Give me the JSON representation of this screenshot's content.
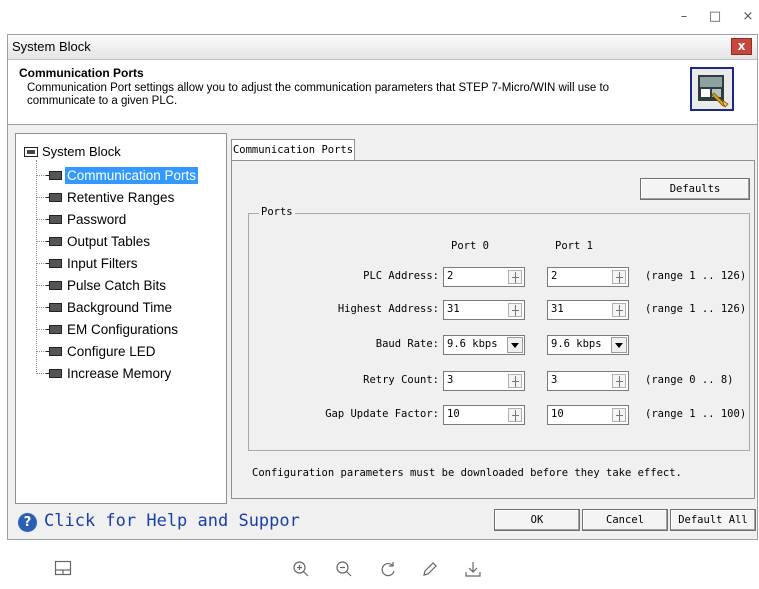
{
  "window": {
    "minimize": "–",
    "maximize": "□",
    "close": "×"
  },
  "dialog": {
    "title": "System Block",
    "close": "x",
    "header": {
      "title": "Communication Ports",
      "description": "Communication Port settings allow you to adjust the communication parameters that STEP 7-Micro/WIN will use to communicate to a given PLC."
    }
  },
  "tree": {
    "root": "System Block",
    "items": [
      "Communication Ports",
      "Retentive Ranges",
      "Password",
      "Output Tables",
      "Input Filters",
      "Pulse Catch Bits",
      "Background Time",
      "EM Configurations",
      "Configure LED",
      "Increase Memory"
    ],
    "selected_index": 0
  },
  "tab": {
    "label": "Communication Ports"
  },
  "panel": {
    "defaults_button": "Defaults",
    "group_label": "Ports",
    "port0_header": "Port 0",
    "port1_header": "Port 1",
    "rows": {
      "plc_address": {
        "label": "PLC Address:",
        "port0": "2",
        "port1": "2",
        "range": "(range 1 .. 126)"
      },
      "highest_address": {
        "label": "Highest Address:",
        "port0": "31",
        "port1": "31",
        "range": "(range 1 .. 126)"
      },
      "baud_rate": {
        "label": "Baud Rate:",
        "port0": "9.6 kbps",
        "port1": "9.6 kbps"
      },
      "retry_count": {
        "label": "Retry Count:",
        "port0": "3",
        "port1": "3",
        "range": "(range 0 .. 8)"
      },
      "gap_update": {
        "label": "Gap Update Factor:",
        "port0": "10",
        "port1": "10",
        "range": "(range 1 .. 100)"
      }
    },
    "note": "Configuration parameters must be downloaded before they take effect."
  },
  "footer": {
    "help_text": "Click for Help and Suppor",
    "ok": "OK",
    "cancel": "Cancel",
    "default_all": "Default All"
  },
  "viewer_toolbar": {
    "icons": [
      "layout-icon",
      "zoom-in-icon",
      "zoom-out-icon",
      "rotate-icon",
      "edit-icon",
      "download-icon"
    ]
  }
}
